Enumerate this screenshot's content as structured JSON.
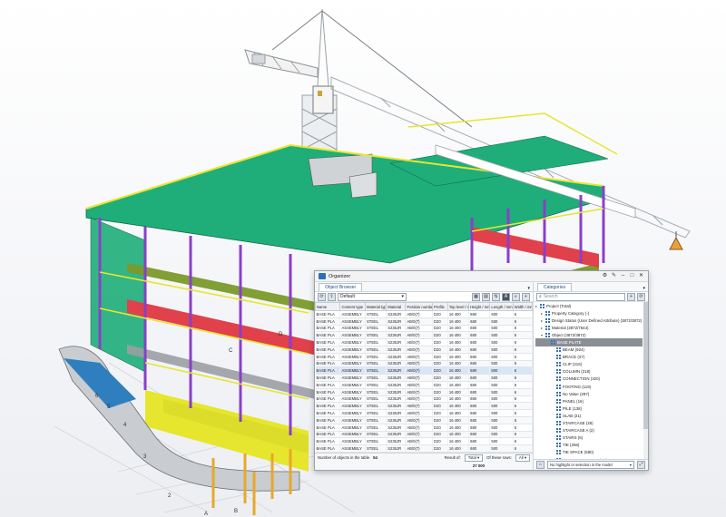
{
  "colors": {
    "slab_green": "#1fae7a",
    "slab_olive": "#7a9a2a",
    "column_purple": "#8a3fc8",
    "beam_yellow": "#e6e62e",
    "red_zone": "#e0414b",
    "crane_white": "#f2f2f2",
    "accent_blue": "#2c6fbd"
  },
  "organizer": {
    "title": "Organizer",
    "icon": "tekla-organizer-icon",
    "tab": "Object Browser",
    "toolbar": {
      "filter_value": "Default"
    },
    "columns": [
      "Name",
      "Content type",
      "Material type",
      "Material",
      "Position number",
      "Profile",
      "Top level / mm",
      "Height / mm",
      "Length / mm",
      "Width / mm"
    ],
    "rows": [
      [
        "BASE PLA",
        "ASSEMBLY",
        "STEEL",
        "S235JR",
        "AB/0(7)",
        "D20",
        "16 400",
        "680",
        "500",
        "6"
      ],
      [
        "BASE PLA",
        "ASSEMBLY",
        "STEEL",
        "S235JR",
        "AB/0(7)",
        "D20",
        "16 400",
        "680",
        "500",
        "6"
      ],
      [
        "BASE PLA",
        "ASSEMBLY",
        "STEEL",
        "S235JR",
        "AB/0(7)",
        "D20",
        "16 400",
        "680",
        "500",
        "6"
      ],
      [
        "BASE PLA",
        "ASSEMBLY",
        "STEEL",
        "S235JR",
        "AB/0(7)",
        "D20",
        "16 400",
        "680",
        "500",
        "6"
      ],
      [
        "BASE PLA",
        "ASSEMBLY",
        "STEEL",
        "S235JR",
        "AB/0(7)",
        "D20",
        "16 400",
        "680",
        "500",
        "6"
      ],
      [
        "BASE PLA",
        "ASSEMBLY",
        "STEEL",
        "S235JR",
        "AB/0(7)",
        "D20",
        "16 400",
        "680",
        "500",
        "6"
      ],
      [
        "BASE PLA",
        "ASSEMBLY",
        "STEEL",
        "S235JR",
        "AB/0(7)",
        "D20",
        "16 400",
        "680",
        "500",
        "6"
      ],
      [
        "BASE PLA",
        "ASSEMBLY",
        "STEEL",
        "S235JR",
        "AB/0(7)",
        "D20",
        "16 400",
        "680",
        "500",
        "6"
      ],
      [
        "BASE PLA",
        "ASSEMBLY",
        "STEEL",
        "S235JR",
        "AB/0(7)",
        "D20",
        "16 400",
        "680",
        "500",
        "6"
      ],
      [
        "BASE PLA",
        "ASSEMBLY",
        "STEEL",
        "S235JR",
        "AB/0(7)",
        "D20",
        "16 400",
        "680",
        "500",
        "6"
      ],
      [
        "BASE PLA",
        "ASSEMBLY",
        "STEEL",
        "S235JR",
        "AB/0(7)",
        "D20",
        "16 400",
        "680",
        "500",
        "6"
      ],
      [
        "BASE PLA",
        "ASSEMBLY",
        "STEEL",
        "S235JR",
        "AB/0(7)",
        "D20",
        "16 400",
        "680",
        "500",
        "6"
      ],
      [
        "BASE PLA",
        "ASSEMBLY",
        "STEEL",
        "S235JR",
        "AB/0(7)",
        "D20",
        "16 400",
        "680",
        "500",
        "6"
      ],
      [
        "BASE PLA",
        "ASSEMBLY",
        "STEEL",
        "S235JR",
        "AB/0(7)",
        "D20",
        "16 400",
        "680",
        "500",
        "6"
      ],
      [
        "BASE PLA",
        "ASSEMBLY",
        "STEEL",
        "S235JR",
        "AB/0(7)",
        "D20",
        "16 400",
        "680",
        "500",
        "6"
      ],
      [
        "BASE PLA",
        "ASSEMBLY",
        "STEEL",
        "S235JR",
        "AB/0(7)",
        "D20",
        "16 400",
        "680",
        "500",
        "6"
      ],
      [
        "BASE PLA",
        "ASSEMBLY",
        "STEEL",
        "S235JR",
        "AB/0(7)",
        "D20",
        "16 400",
        "680",
        "500",
        "6"
      ],
      [
        "BASE PLA",
        "ASSEMBLY",
        "STEEL",
        "S235JR",
        "AB/0(7)",
        "D20",
        "16 400",
        "680",
        "500",
        "6"
      ],
      [
        "BASE PLA",
        "ASSEMBLY",
        "STEEL",
        "S235JR",
        "AB/0(7)",
        "D20",
        "16 400",
        "680",
        "500",
        "6"
      ],
      [
        "BASE PLA",
        "ASSEMBLY",
        "STEEL",
        "S235JR",
        "AB/0(7)",
        "D20",
        "16 400",
        "680",
        "500",
        "6"
      ],
      [
        "BASE PLA",
        "ASSEMBLY",
        "STEEL",
        "S235JR",
        "AB/0(7)",
        "D20",
        "16 400",
        "680",
        "500",
        "6"
      ],
      [
        "BASE PLA",
        "ASSEMBLY",
        "STEEL",
        "S235JR",
        "AB/0(7)",
        "D20",
        "16 400",
        "680",
        "500",
        "6"
      ]
    ],
    "footer": {
      "count_label": "Number of objects in the table",
      "count_value": "54",
      "result_label": "Result of:",
      "result_value": "Total",
      "show_label": "Of these rows:",
      "show_value": "All",
      "sum_value": "27 000"
    }
  },
  "categories": {
    "tab": "Categories",
    "search_placeholder": "Search",
    "items": [
      {
        "label": "Project (Total)",
        "level": 0,
        "arrow": "▸"
      },
      {
        "label": "Property Category (-)",
        "level": 1,
        "arrow": "▸"
      },
      {
        "label": "Design Status (User Defined Attribute) (3872/3872)",
        "level": 1,
        "arrow": "▸"
      },
      {
        "label": "Material (3872/7544)",
        "level": 1,
        "arrow": "▸"
      },
      {
        "label": "Object (3872/3872)",
        "level": 1,
        "arrow": "▾"
      },
      {
        "label": "BASE PLATE",
        "level": 2,
        "arrow": "",
        "selected": true
      },
      {
        "label": "BEAM (924)",
        "level": 3,
        "arrow": ""
      },
      {
        "label": "BRACE (37)",
        "level": 3,
        "arrow": ""
      },
      {
        "label": "CLIP (216)",
        "level": 3,
        "arrow": ""
      },
      {
        "label": "COLUMN (218)",
        "level": 3,
        "arrow": ""
      },
      {
        "label": "CONNECTION (320)",
        "level": 3,
        "arrow": ""
      },
      {
        "label": "FOOTING (119)",
        "level": 3,
        "arrow": ""
      },
      {
        "label": "No Value (287)",
        "level": 3,
        "arrow": ""
      },
      {
        "label": "PANEL (16)",
        "level": 3,
        "arrow": ""
      },
      {
        "label": "PILE (138)",
        "level": 3,
        "arrow": ""
      },
      {
        "label": "SLAB (21)",
        "level": 3,
        "arrow": ""
      },
      {
        "label": "STAIRCASE (28)",
        "level": 3,
        "arrow": ""
      },
      {
        "label": "STAIRCASE A (2)",
        "level": 3,
        "arrow": ""
      },
      {
        "label": "STAIRS (6)",
        "level": 3,
        "arrow": ""
      },
      {
        "label": "TIE (258)",
        "level": 3,
        "arrow": ""
      },
      {
        "label": "TIE SPACE (580)",
        "level": 3,
        "arrow": ""
      },
      {
        "label": "WALL FORMWORK (26)",
        "level": 3,
        "arrow": ""
      }
    ],
    "footer_text": "No highlight or selection in the model"
  },
  "grid_labels": [
    "A",
    "B",
    "C",
    "D",
    "2",
    "3",
    "4",
    "5",
    "6"
  ]
}
